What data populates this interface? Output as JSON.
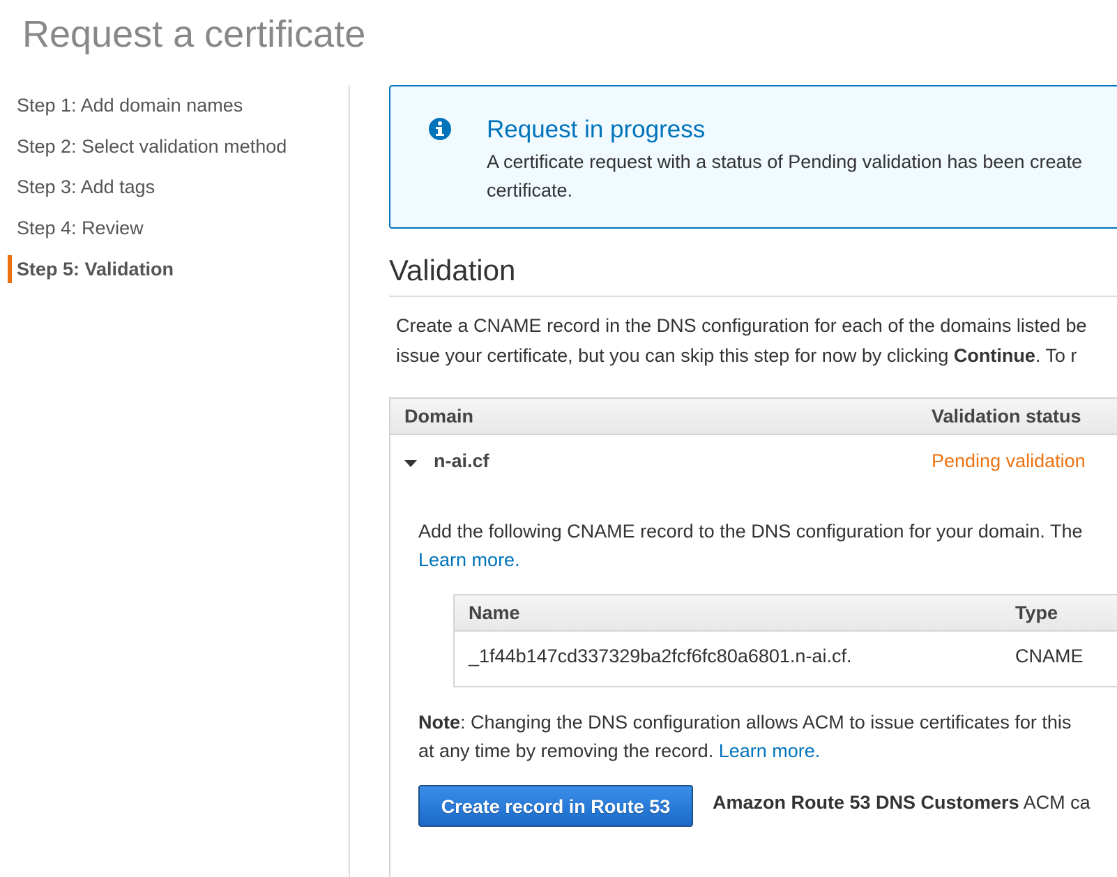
{
  "page_title": "Request a certificate",
  "steps": [
    {
      "label": "Step 1: Add domain names",
      "active": false
    },
    {
      "label": "Step 2: Select validation method",
      "active": false
    },
    {
      "label": "Step 3: Add tags",
      "active": false
    },
    {
      "label": "Step 4: Review",
      "active": false
    },
    {
      "label": "Step 5: Validation",
      "active": true
    }
  ],
  "alert": {
    "icon": "info-icon",
    "title": "Request in progress",
    "body_line1": "A certificate request with a status of Pending validation has been create",
    "body_line2": "certificate."
  },
  "validation": {
    "title": "Validation",
    "desc_line1": "Create a CNAME record in the DNS configuration for each of the domains listed be",
    "desc_line2_before": "issue your certificate, but you can skip this step for now by clicking ",
    "desc_line2_bold": "Continue",
    "desc_line2_after": ". To r"
  },
  "domain_table": {
    "col_domain": "Domain",
    "col_status": "Validation status",
    "row": {
      "domain": "n-ai.cf",
      "status": "Pending validation",
      "status_color": "#ec7211"
    }
  },
  "instructions": {
    "line1": "Add the following CNAME record to the DNS configuration for your domain. The",
    "learn_more": "Learn more."
  },
  "cname_table": {
    "col_name": "Name",
    "col_type": "Type",
    "name": "_1f44b147cd337329ba2fcf6fc80a6801.n-ai.cf.",
    "type": "CNAME"
  },
  "note": {
    "label": "Note",
    "line1_rest": ": Changing the DNS configuration allows ACM to issue certificates for this",
    "line2": "at any time by removing the record. ",
    "learn_more": "Learn more."
  },
  "route53": {
    "button_label": "Create record in Route 53",
    "note_bold": "Amazon Route 53 DNS Customers",
    "note_rest": " ACM ca"
  },
  "colors": {
    "accent_link": "#0073bb",
    "active_step_bar": "#ec7211",
    "pending": "#ec7211",
    "alert_bg": "#f1faff"
  }
}
